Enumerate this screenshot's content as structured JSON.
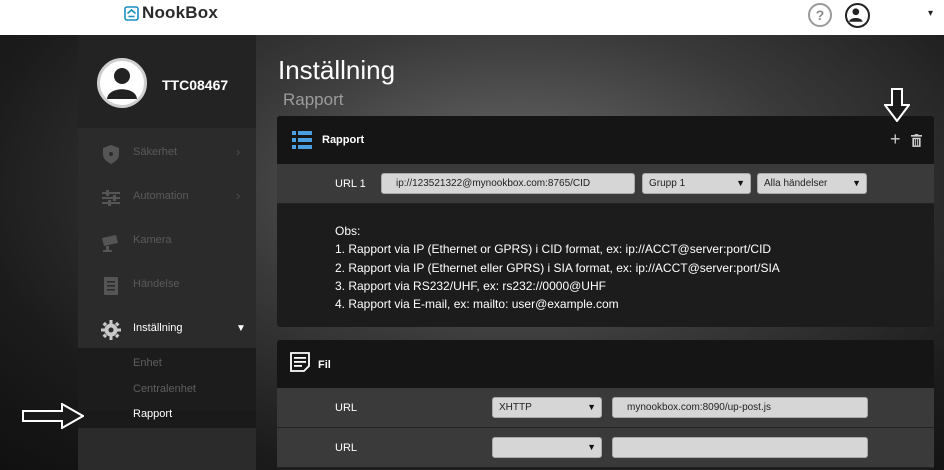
{
  "topbar": {
    "brand": "NookBox",
    "help_label": "?"
  },
  "sidebar": {
    "username": "TTC08467",
    "items": [
      {
        "label": "Säkerhet",
        "icon": "shield-icon",
        "has_arrow": true
      },
      {
        "label": "Automation",
        "icon": "sliders-icon",
        "has_arrow": true
      },
      {
        "label": "Kamera",
        "icon": "camera-icon",
        "has_arrow": false
      },
      {
        "label": "Händelse",
        "icon": "list-icon",
        "has_arrow": false
      },
      {
        "label": "Inställning",
        "icon": "gear-icon",
        "has_arrow": true,
        "active": true
      }
    ],
    "sub_items": [
      {
        "label": "Enhet"
      },
      {
        "label": "Centralenhet"
      },
      {
        "label": "Rapport",
        "active": true
      }
    ]
  },
  "page": {
    "title": "Inställning",
    "subtitle": "Rapport"
  },
  "rapport_panel": {
    "title": "Rapport",
    "add_label": "+",
    "url_row": {
      "label": "URL 1",
      "url_value": "ip://123521322@mynookbox.com:8765/CID",
      "group_select": "Grupp 1",
      "event_select": "Alla händelser"
    },
    "notes": [
      "Obs:",
      "1. Rapport via IP (Ethernet or GPRS) i CID format, ex: ip://ACCT@server:port/CID",
      "2. Rapport via IP (Ethernet eller GPRS) i SIA format, ex: ip://ACCT@server:port/SIA",
      "3. Rapport via RS232/UHF, ex: rs232://0000@UHF",
      "4. Rapport via E-mail, ex: mailto: user@example.com"
    ]
  },
  "fil_panel": {
    "title": "Fil",
    "rows": [
      {
        "label": "URL",
        "method": "XHTTP",
        "url_value": "mynookbox.com:8090/up-post.js"
      },
      {
        "label": "URL",
        "method": "",
        "url_value": ""
      }
    ]
  },
  "colors": {
    "sidebar_bg": "#2b2b2b",
    "panel_header": "#151515",
    "row_bg": "#3a3a3a",
    "field_bg": "#d6d6d6",
    "accent_icon": "#4a9fe0"
  }
}
